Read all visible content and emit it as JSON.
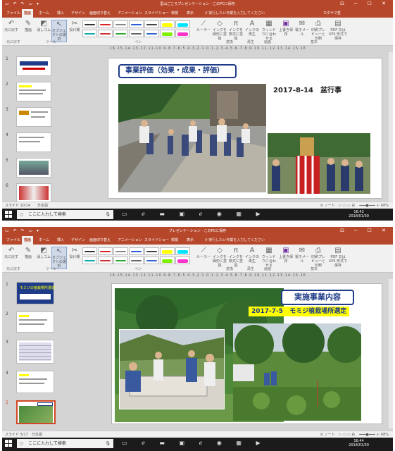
{
  "shot1": {
    "quick_access": "▭ ↶ ↷ ▭ ▾",
    "window_title": "里山ごころプレゼンテーション - このPCに保存",
    "window_controls": "⊡ ─ ☐ ✕",
    "tabs": [
      "ファイル",
      "ホーム",
      "挿入",
      "デザイン",
      "画面切り替え",
      "アニメーション",
      "スライドショー",
      "校閲",
      "表示"
    ],
    "active_tab": "描画",
    "tell_me": "♀ 実行したい作業を入力してください",
    "account": "カタヤマ哲",
    "ribbon": {
      "undo": "元に戻す",
      "draw": "描画",
      "eraser": "消しゴム",
      "lasso": "投げ縄",
      "select_objects": "オブジェクトの選択",
      "ink_replay": "インクの再生",
      "ruler": "ルーラー",
      "ink_to_shape": "インクを図形に変換",
      "ink_to_math": "インクを数式に変換",
      "highlighter": "蛍光ペン",
      "ink_replay2": "インクの再生",
      "fit_window": "ウィンドウに合わせる",
      "overwrite_save": "上書き保存",
      "email": "電子メール",
      "print_preview": "印刷プレビューと印刷",
      "pdf": "PDF 又は XPS 形式で保存"
    },
    "groups": [
      "元に戻す",
      "ツール",
      "ペン",
      "変換",
      "再生",
      "画面",
      "基本"
    ],
    "ruler_text": "·16·15·14·13·12·11·10·9·8·7·6·5·4·3·2·1·0·1·2·3·4·5·6·7·8·9·10·11·12·13·14·15·16",
    "slide_numbers": [
      "1",
      "2",
      "3",
      "4",
      "5",
      "6"
    ],
    "slide_title": "事業評価（効果・成果・評価）",
    "slide_date": "2017-8-14　盆行事",
    "status_left": "スライド 10/14　　日本語",
    "status_right": "≡ ノート　▭ ▭ ▭ ⊞　 ━━━●━━━ ＋ 68%",
    "search_placeholder": "ここに入力して検索",
    "clock_time": "16:42",
    "clock_date": "2018/01/30"
  },
  "shot2": {
    "window_title": "プレゼンテーション - このPCに保存",
    "tabs": [
      "ファイル",
      "ホーム",
      "挿入",
      "デザイン",
      "画面切り替え",
      "アニメーション",
      "スライドショー",
      "校閲",
      "表示"
    ],
    "active_tab": "描画",
    "tell_me": "♀ 実行したい作業を入力してください",
    "slide_numbers": [
      "1",
      "2",
      "3",
      "4",
      "5"
    ],
    "slide_title": "実施事業内容",
    "slide_subtitle_date": "2017-7-5",
    "slide_subtitle_text": "モミジ植栽場所選定",
    "thumb1_title": "モミジの植栽場所選定",
    "status_left": "スライド 5/17　日本語",
    "status_right": "≡ ノート　▭ ▭ ▭ ⊞　 ━━━●━━━ ＋ 68%",
    "search_placeholder": "ここに入力して検索",
    "clock_time": "16:44",
    "clock_date": "2018/01/30"
  },
  "colors": {
    "accent": "#b7472a",
    "title_blue": "#1f3c88",
    "highlight_yellow": "#ffff00"
  }
}
